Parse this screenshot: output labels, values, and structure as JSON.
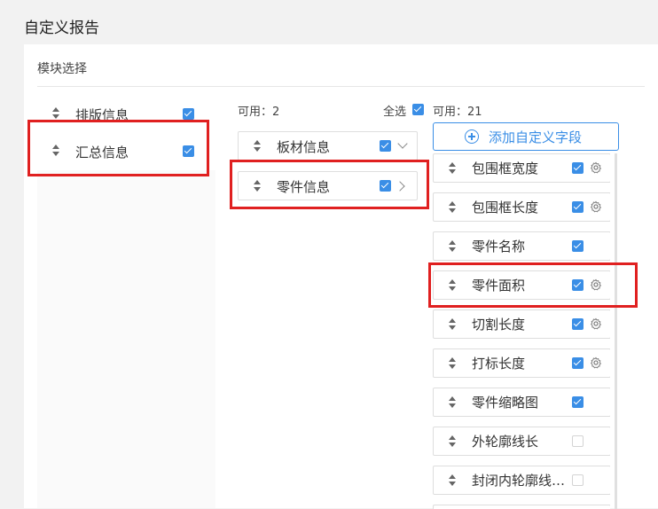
{
  "page": {
    "title": "自定义报告"
  },
  "panel": {
    "title": "模块选择"
  },
  "modules": [
    {
      "label": "排版信息",
      "checked": true
    },
    {
      "label": "汇总信息",
      "checked": true
    }
  ],
  "middle": {
    "available_label": "可用：2",
    "select_all_label": "全选",
    "groups": [
      {
        "label": "板材信息",
        "checked": true,
        "chevron": "chevron-down-icon"
      },
      {
        "label": "零件信息",
        "checked": true,
        "chevron": "chevron-right-icon"
      }
    ]
  },
  "right": {
    "available_label": "可用：21",
    "add_button_label": "添加自定义字段",
    "fields": [
      {
        "label": "包围框宽度",
        "checked": true,
        "settings": true
      },
      {
        "label": "包围框长度",
        "checked": true,
        "settings": true
      },
      {
        "label": "零件名称",
        "checked": true,
        "settings": false
      },
      {
        "label": "零件面积",
        "checked": true,
        "settings": true
      },
      {
        "label": "切割长度",
        "checked": true,
        "settings": true
      },
      {
        "label": "打标长度",
        "checked": true,
        "settings": true
      },
      {
        "label": "零件缩略图",
        "checked": true,
        "settings": false
      },
      {
        "label": "外轮廓线长",
        "checked": false,
        "settings": false
      },
      {
        "label": "封闭内轮廓线…",
        "checked": false,
        "settings": false
      }
    ]
  },
  "colors": {
    "accent": "#3a8ee6",
    "highlight": "#e02020"
  }
}
